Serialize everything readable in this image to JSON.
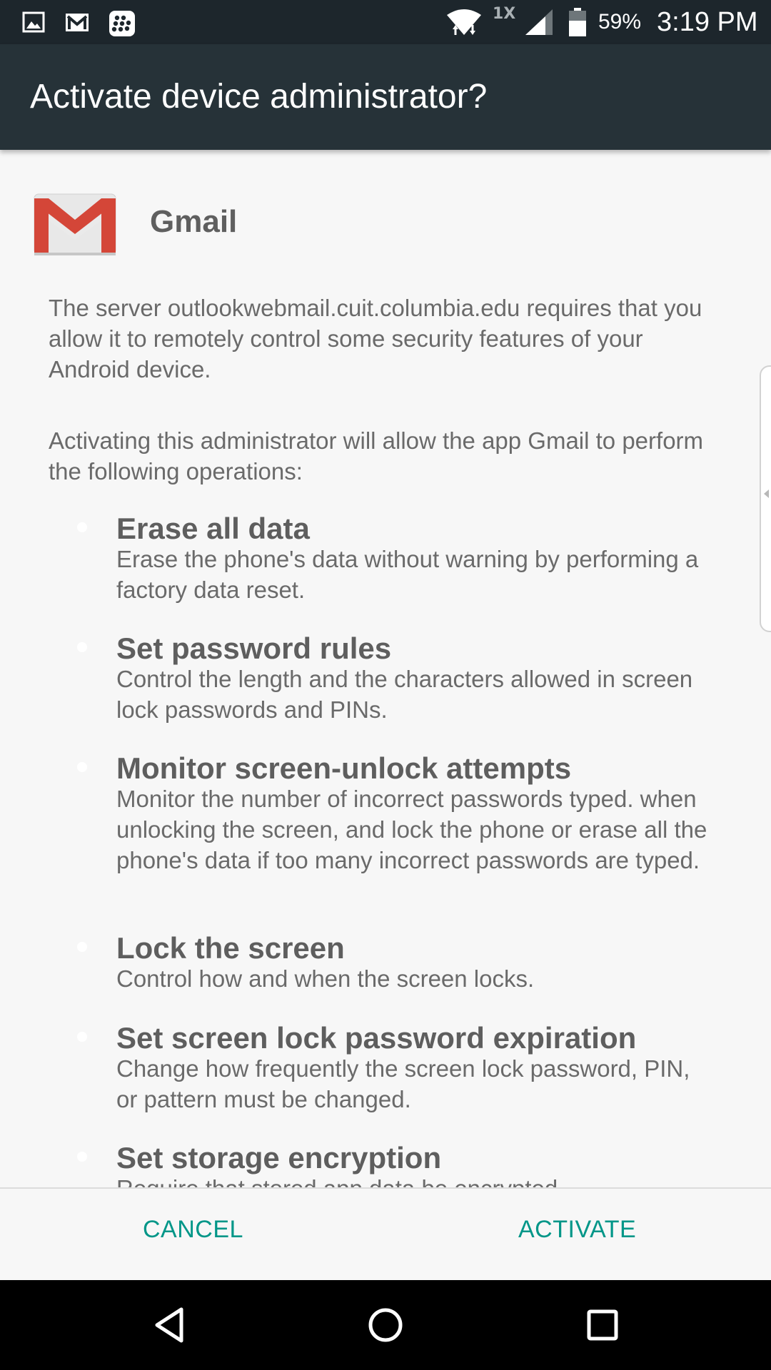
{
  "status_bar": {
    "left_icons": [
      "image-icon",
      "gmail-icon",
      "blackberry-icon"
    ],
    "network_label": "1X",
    "battery_percent": "59%",
    "time": "3:19 PM"
  },
  "app_bar": {
    "title": "Activate device administrator?"
  },
  "app": {
    "name": "Gmail",
    "icon": "gmail-icon"
  },
  "description": "The server outlookwebmail.cuit.columbia.edu requires that you allow it to remotely control some security features of your Android device.",
  "operations_intro": "Activating this administrator will allow the app Gmail to perform the following operations:",
  "permissions": [
    {
      "title": "Erase all data",
      "description": "Erase the phone's data without warning by performing a factory data reset."
    },
    {
      "title": "Set password rules",
      "description": "Control the length and the characters allowed in screen lock passwords and PINs."
    },
    {
      "title": "Monitor screen-unlock attempts",
      "description": "Monitor the number of incorrect passwords typed. when unlocking the screen, and lock the phone or erase all the phone's data if too many incorrect passwords are typed."
    },
    {
      "title": "Lock the screen",
      "description": "Control how and when the screen locks."
    },
    {
      "title": "Set screen lock password expiration",
      "description": "Change how frequently the screen lock password, PIN, or pattern must be changed."
    },
    {
      "title": "Set storage encryption",
      "description": "Require that stored app data be encrypted."
    }
  ],
  "buttons": {
    "cancel": "CANCEL",
    "activate": "ACTIVATE"
  },
  "colors": {
    "status_bar": "#1d262c",
    "app_bar": "#263238",
    "accent": "#009688",
    "gmail_red": "#d44638"
  },
  "nav_bar": {
    "icons": [
      "back-icon",
      "home-icon",
      "recents-icon"
    ]
  }
}
